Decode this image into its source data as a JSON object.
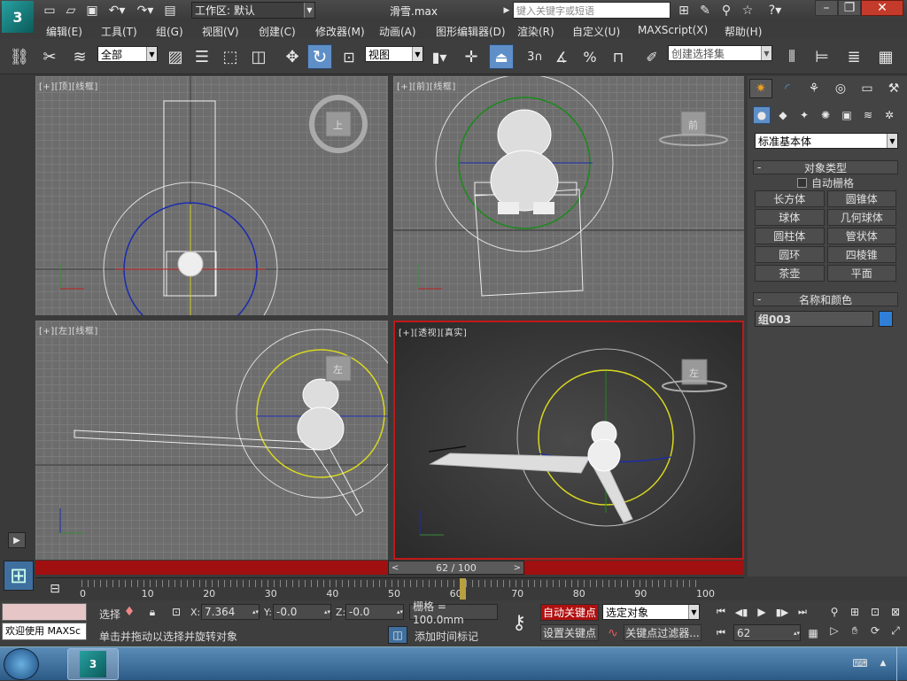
{
  "title_bar": {
    "workspace_label": "工作区: 默认",
    "file_name": "滑雪.max",
    "search_placeholder": "键入关键字或短语"
  },
  "menu": [
    "编辑(E)",
    "工具(T)",
    "组(G)",
    "视图(V)",
    "创建(C)",
    "修改器(M)",
    "动画(A)",
    "图形编辑器(D)",
    "渲染(R)",
    "自定义(U)",
    "MAXScript(X)",
    "帮助(H)"
  ],
  "toolbar": {
    "filter_select": "全部",
    "ref_coord_select": "视图",
    "selection_set_placeholder": "创建选择集"
  },
  "viewports": {
    "top": {
      "plus": "[+]",
      "name": "[顶]",
      "mode": "[线框]",
      "cube_label": "上"
    },
    "front": {
      "plus": "[+]",
      "name": "[前]",
      "mode": "[线框]",
      "cube_label": "前"
    },
    "left": {
      "plus": "[+]",
      "name": "[左]",
      "mode": "[线框]",
      "cube_label": "左"
    },
    "perspective": {
      "plus": "[+]",
      "name": "[透视]",
      "mode": "[真实]",
      "cube_label": "左"
    }
  },
  "command_panel": {
    "category_select": "标准基本体",
    "object_type_title": "对象类型",
    "auto_grid_label": "自动栅格",
    "object_buttons": [
      "长方体",
      "圆锥体",
      "球体",
      "几何球体",
      "圆柱体",
      "管状体",
      "圆环",
      "四棱锥",
      "茶壶",
      "平面"
    ],
    "name_color_title": "名称和颜色",
    "object_name": "组003",
    "object_color": "#2f7fd8"
  },
  "timeline": {
    "slider_label": "62 / 100",
    "ticks": [
      "0",
      "10",
      "20",
      "30",
      "40",
      "50",
      "60",
      "70",
      "80",
      "90",
      "100"
    ],
    "current_frame": 62,
    "total_frames": 100
  },
  "status": {
    "maxscript_listener": "欢迎使用 MAXSc",
    "selection_label": "选择",
    "x_label": "X:",
    "x_value": "7.364",
    "y_label": "Y:",
    "y_value": "-0.0",
    "z_label": "Z:",
    "z_value": "-0.0",
    "grid_label": "栅格 = 100.0mm",
    "prompt": "单击并拖动以选择并旋转对象",
    "add_time_tag": "添加时间标记",
    "auto_key": "自动关键点",
    "set_key": "设置关键点",
    "key_mode_select": "选定对象",
    "key_filter": "关键点过滤器...",
    "frame_field": "62"
  },
  "colors": {
    "auto_key_active": "#b01010",
    "selected_viewport_border": "#c01818",
    "timeline_red": "#a01010"
  }
}
